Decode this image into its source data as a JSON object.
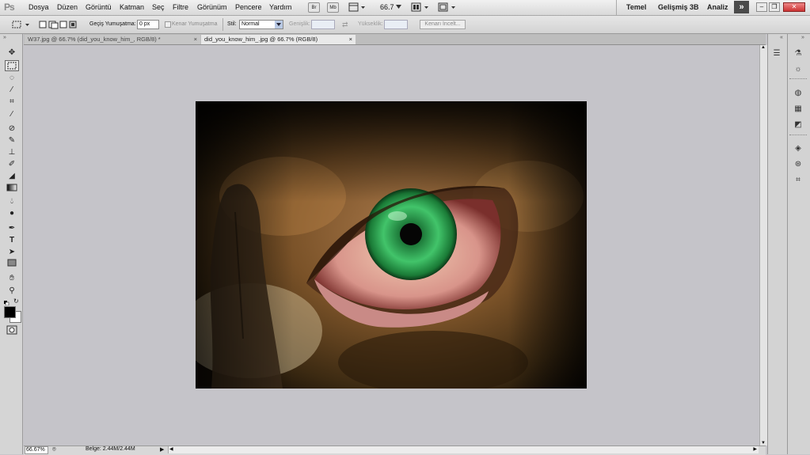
{
  "app": {
    "logo": "Ps"
  },
  "menu": [
    "Dosya",
    "Düzen",
    "Görüntü",
    "Katman",
    "Seç",
    "Filtre",
    "Görünüm",
    "Pencere",
    "Yardım"
  ],
  "menubar_icons": {
    "br": "Br",
    "mb": "Mb",
    "zoom": "66.7"
  },
  "workspaces": [
    "Temel",
    "Gelişmiş 3B",
    "Analiz"
  ],
  "options": {
    "feather_label": "Geçiş Yumuşatma:",
    "feather_value": "0 px",
    "antialias_label": "Kenar Yumuşatma",
    "style_label": "Stil:",
    "style_value": "Normal",
    "width_label": "Genişlik:",
    "height_label": "Yükseklik:",
    "refine_label": "Kenarı İncelt..."
  },
  "tabs": [
    {
      "label": "W37.jpg @ 66.7% (did_you_know_him_, RGB/8) *",
      "active": false
    },
    {
      "label": "did_you_know_him_.jpg @ 66.7% (RGB/8)",
      "active": true
    }
  ],
  "status": {
    "zoom": "66.67%",
    "doc": "Belge: 2.44M/2.44M"
  },
  "colors": {
    "foreground": "#000000",
    "background": "#ffffff",
    "iris": "#2fae5a"
  }
}
